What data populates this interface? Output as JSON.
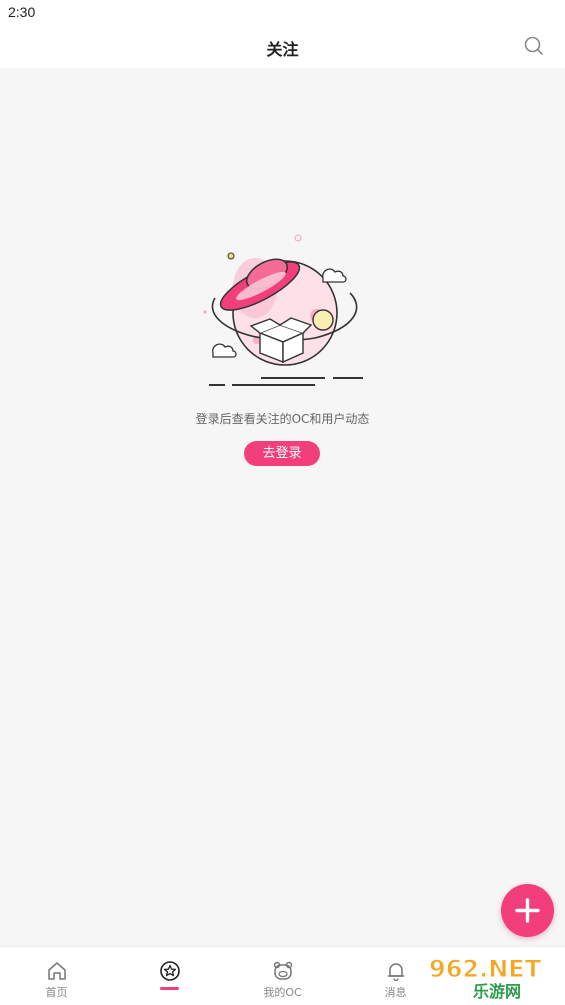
{
  "status_bar": {
    "time": "2:30"
  },
  "header": {
    "title": "关注",
    "search_icon": "search-icon"
  },
  "empty_state": {
    "message": "登录后查看关注的OC和用户动态",
    "login_button": "去登录"
  },
  "fab": {
    "icon": "plus-icon",
    "color": "#f23f7c"
  },
  "tabbar": {
    "tabs": [
      {
        "label": "首页",
        "icon": "home-icon",
        "active": false
      },
      {
        "label": "",
        "icon": "star-circle-icon",
        "active": true
      },
      {
        "label": "我的OC",
        "icon": "mascot-icon",
        "active": false
      },
      {
        "label": "消息",
        "icon": "bell-icon",
        "active": false
      }
    ]
  },
  "watermark": {
    "top": "962.NET",
    "bottom": "乐游网"
  },
  "colors": {
    "accent": "#f23f7c",
    "background": "#f6f6f7"
  }
}
